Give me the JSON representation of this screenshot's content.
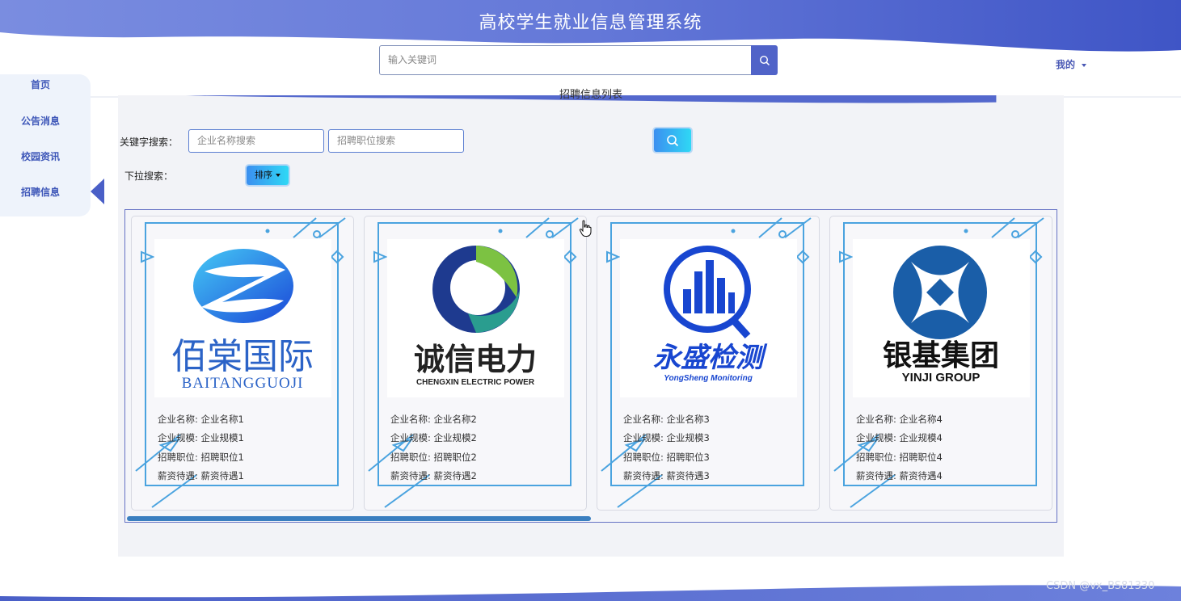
{
  "app": {
    "title": "高校学生就业信息管理系统"
  },
  "header": {
    "search_placeholder": "输入关键词",
    "user_menu_label": "我的",
    "brand_color": "#4a5fc7"
  },
  "sidebar": {
    "items": [
      {
        "label": "首页",
        "active": false
      },
      {
        "label": "公告消息",
        "active": false
      },
      {
        "label": "校园资讯",
        "active": false
      },
      {
        "label": "招聘信息",
        "active": true
      }
    ]
  },
  "main": {
    "section_title": "招聘信息列表",
    "filters": {
      "keyword_label": "关键字搜索：",
      "company_placeholder": "企业名称搜索",
      "position_placeholder": "招聘职位搜索",
      "dropdown_label": "下拉搜索：",
      "sort_label": "排序"
    },
    "cards": [
      {
        "logo_cn": "佰棠国际",
        "logo_en": "BAITANGGUOJI",
        "logo_icon": "z-swirl-logo",
        "company": "企业名称: 企业名称1",
        "scale": "企业规模: 企业规模1",
        "position": "招聘职位: 招聘职位1",
        "salary": "薪资待遇: 薪资待遇1"
      },
      {
        "logo_cn": "诚信电力",
        "logo_en": "CHENGXIN ELECTRIC POWER",
        "logo_icon": "ring-swoosh-logo",
        "company": "企业名称: 企业名称2",
        "scale": "企业规模: 企业规模2",
        "position": "招聘职位: 招聘职位2",
        "salary": "薪资待遇: 薪资待遇2"
      },
      {
        "logo_cn": "永盛检测",
        "logo_en": "YongSheng Monitoring",
        "logo_icon": "magnifier-bars-logo",
        "company": "企业名称: 企业名称3",
        "scale": "企业规模: 企业规模3",
        "position": "招聘职位: 招聘职位3",
        "salary": "薪资待遇: 薪资待遇3"
      },
      {
        "logo_cn": "银基集团",
        "logo_en": "YINJI GROUP",
        "logo_icon": "x-circle-logo",
        "company": "企业名称: 企业名称4",
        "scale": "企业规模: 企业规模4",
        "position": "招聘职位: 招聘职位4",
        "salary": "薪资待遇: 薪资待遇4"
      }
    ]
  },
  "footer": {
    "watermark": "CSDN @vx_BS81330"
  }
}
